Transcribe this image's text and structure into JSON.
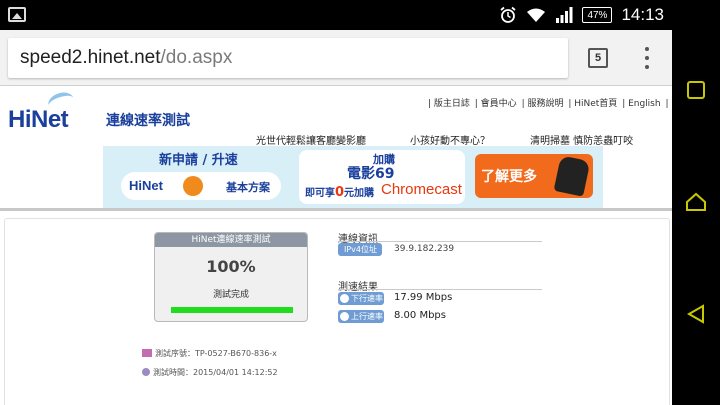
{
  "status_bar": {
    "battery": "47%",
    "time": "14:13"
  },
  "browser": {
    "url_host": "speed2.hinet.net",
    "url_path": "/do.aspx",
    "tab_count": "5"
  },
  "site": {
    "logo": "HiNet",
    "title": "連線速率測試",
    "top_links": [
      "| 版主日誌",
      "| 會員中心",
      "| 服務說明",
      "| HiNet首頁",
      "| English",
      "|"
    ],
    "promo_links": [
      "光世代輕鬆讓客廳變影廳",
      "小孩好動不專心？",
      "清明掃墓 慎防恙蟲叮咬"
    ]
  },
  "banner": {
    "headline": "新申請 / 升速",
    "brand": "HiNet",
    "plan": "基本方案",
    "buy": "加購",
    "movie": "電影69",
    "add_prefix": "即可享",
    "add_zero": "0",
    "add_suffix": "元加購",
    "chromecast": "Chromecast",
    "learn_more": "了解更多"
  },
  "speed_test": {
    "panel_title": "HiNet連線速率測試",
    "progress_text": "100%",
    "progress": 1.0,
    "status": "測試完成",
    "serial_label": "測試序號：TP-0527-B670-836-x",
    "time_label": "測試時間：2015/04/01 14:12:52"
  },
  "connection": {
    "title": "連線資訊",
    "ipv4_label": "IPv4位址",
    "ipv4": "39.9.182.239"
  },
  "results": {
    "title": "測速結果",
    "download_label": "下行速率",
    "download": "17.99 Mbps",
    "upload_label": "上行速率",
    "upload": "8.00 Mbps"
  },
  "colors": {
    "brand_blue": "#1a3f9c",
    "progress_green": "#1fdc1f",
    "pill_blue": "#6f9cd3",
    "banner_orange": "#f26a1b"
  }
}
